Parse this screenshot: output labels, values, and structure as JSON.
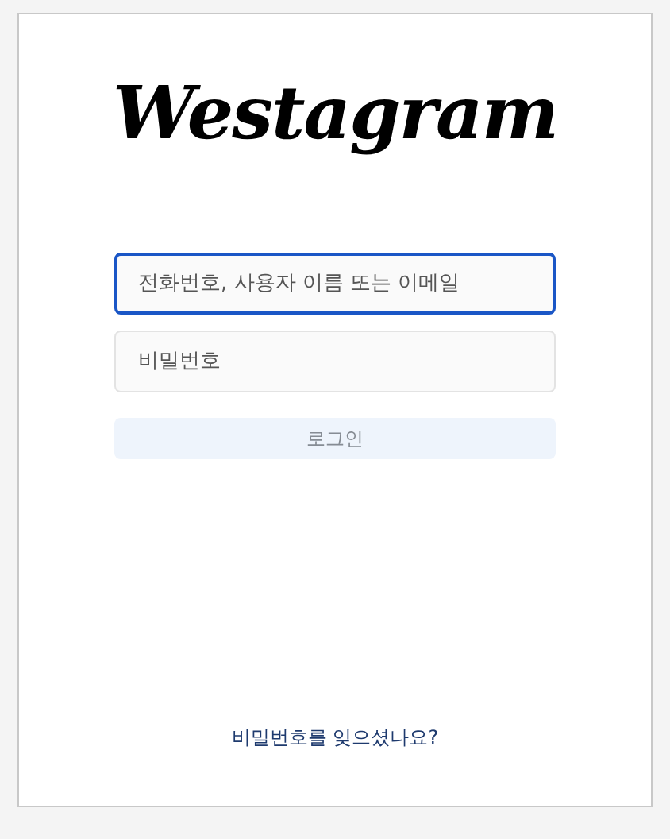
{
  "logo": "Westagram",
  "fields": [
    {
      "placeholder": "전화번호, 사용자 이름 또는 이메일",
      "focused": true
    },
    {
      "placeholder": "비밀번호",
      "focused": false
    }
  ],
  "login_button": {
    "label": "로그인",
    "disabled": true
  },
  "forgot_link": "비밀번호를 잊으셨나요?"
}
